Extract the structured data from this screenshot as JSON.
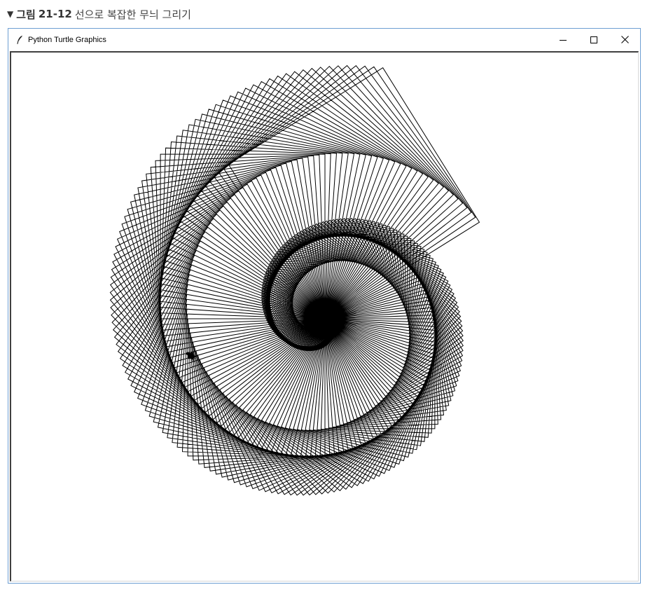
{
  "caption": {
    "marker": "▼",
    "prefix": "그림",
    "number": "21-12",
    "text": "선으로 복잡한 무늬 그리기"
  },
  "window": {
    "title": "Python Turtle Graphics",
    "controls": {
      "minimize": "minimize-icon",
      "maximize": "maximize-icon",
      "close": "close-icon"
    }
  },
  "canvas": {
    "background": "#ffffff",
    "line_color": "#000000",
    "shape": "turtle"
  }
}
